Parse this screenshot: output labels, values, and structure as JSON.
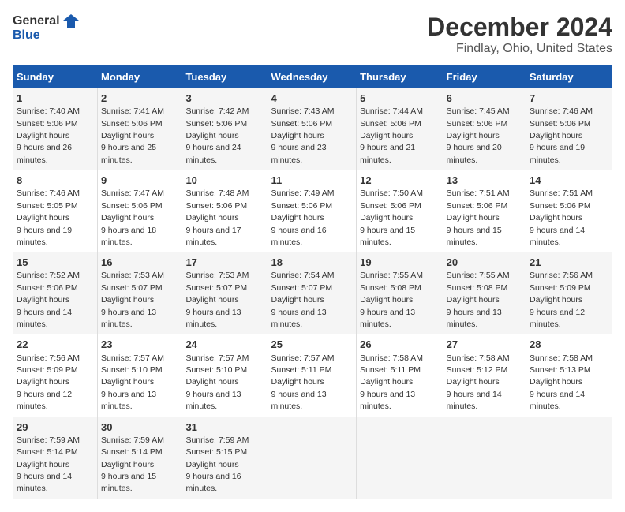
{
  "logo": {
    "line1": "General",
    "line2": "Blue"
  },
  "title": "December 2024",
  "subtitle": "Findlay, Ohio, United States",
  "days_of_week": [
    "Sunday",
    "Monday",
    "Tuesday",
    "Wednesday",
    "Thursday",
    "Friday",
    "Saturday"
  ],
  "weeks": [
    [
      {
        "day": "1",
        "sunrise": "7:40 AM",
        "sunset": "5:06 PM",
        "daylight": "9 hours and 26 minutes."
      },
      {
        "day": "2",
        "sunrise": "7:41 AM",
        "sunset": "5:06 PM",
        "daylight": "9 hours and 25 minutes."
      },
      {
        "day": "3",
        "sunrise": "7:42 AM",
        "sunset": "5:06 PM",
        "daylight": "9 hours and 24 minutes."
      },
      {
        "day": "4",
        "sunrise": "7:43 AM",
        "sunset": "5:06 PM",
        "daylight": "9 hours and 23 minutes."
      },
      {
        "day": "5",
        "sunrise": "7:44 AM",
        "sunset": "5:06 PM",
        "daylight": "9 hours and 21 minutes."
      },
      {
        "day": "6",
        "sunrise": "7:45 AM",
        "sunset": "5:06 PM",
        "daylight": "9 hours and 20 minutes."
      },
      {
        "day": "7",
        "sunrise": "7:46 AM",
        "sunset": "5:06 PM",
        "daylight": "9 hours and 19 minutes."
      }
    ],
    [
      {
        "day": "8",
        "sunrise": "7:46 AM",
        "sunset": "5:05 PM",
        "daylight": "9 hours and 19 minutes."
      },
      {
        "day": "9",
        "sunrise": "7:47 AM",
        "sunset": "5:06 PM",
        "daylight": "9 hours and 18 minutes."
      },
      {
        "day": "10",
        "sunrise": "7:48 AM",
        "sunset": "5:06 PM",
        "daylight": "9 hours and 17 minutes."
      },
      {
        "day": "11",
        "sunrise": "7:49 AM",
        "sunset": "5:06 PM",
        "daylight": "9 hours and 16 minutes."
      },
      {
        "day": "12",
        "sunrise": "7:50 AM",
        "sunset": "5:06 PM",
        "daylight": "9 hours and 15 minutes."
      },
      {
        "day": "13",
        "sunrise": "7:51 AM",
        "sunset": "5:06 PM",
        "daylight": "9 hours and 15 minutes."
      },
      {
        "day": "14",
        "sunrise": "7:51 AM",
        "sunset": "5:06 PM",
        "daylight": "9 hours and 14 minutes."
      }
    ],
    [
      {
        "day": "15",
        "sunrise": "7:52 AM",
        "sunset": "5:06 PM",
        "daylight": "9 hours and 14 minutes."
      },
      {
        "day": "16",
        "sunrise": "7:53 AM",
        "sunset": "5:07 PM",
        "daylight": "9 hours and 13 minutes."
      },
      {
        "day": "17",
        "sunrise": "7:53 AM",
        "sunset": "5:07 PM",
        "daylight": "9 hours and 13 minutes."
      },
      {
        "day": "18",
        "sunrise": "7:54 AM",
        "sunset": "5:07 PM",
        "daylight": "9 hours and 13 minutes."
      },
      {
        "day": "19",
        "sunrise": "7:55 AM",
        "sunset": "5:08 PM",
        "daylight": "9 hours and 13 minutes."
      },
      {
        "day": "20",
        "sunrise": "7:55 AM",
        "sunset": "5:08 PM",
        "daylight": "9 hours and 13 minutes."
      },
      {
        "day": "21",
        "sunrise": "7:56 AM",
        "sunset": "5:09 PM",
        "daylight": "9 hours and 12 minutes."
      }
    ],
    [
      {
        "day": "22",
        "sunrise": "7:56 AM",
        "sunset": "5:09 PM",
        "daylight": "9 hours and 12 minutes."
      },
      {
        "day": "23",
        "sunrise": "7:57 AM",
        "sunset": "5:10 PM",
        "daylight": "9 hours and 13 minutes."
      },
      {
        "day": "24",
        "sunrise": "7:57 AM",
        "sunset": "5:10 PM",
        "daylight": "9 hours and 13 minutes."
      },
      {
        "day": "25",
        "sunrise": "7:57 AM",
        "sunset": "5:11 PM",
        "daylight": "9 hours and 13 minutes."
      },
      {
        "day": "26",
        "sunrise": "7:58 AM",
        "sunset": "5:11 PM",
        "daylight": "9 hours and 13 minutes."
      },
      {
        "day": "27",
        "sunrise": "7:58 AM",
        "sunset": "5:12 PM",
        "daylight": "9 hours and 14 minutes."
      },
      {
        "day": "28",
        "sunrise": "7:58 AM",
        "sunset": "5:13 PM",
        "daylight": "9 hours and 14 minutes."
      }
    ],
    [
      {
        "day": "29",
        "sunrise": "7:59 AM",
        "sunset": "5:14 PM",
        "daylight": "9 hours and 14 minutes."
      },
      {
        "day": "30",
        "sunrise": "7:59 AM",
        "sunset": "5:14 PM",
        "daylight": "9 hours and 15 minutes."
      },
      {
        "day": "31",
        "sunrise": "7:59 AM",
        "sunset": "5:15 PM",
        "daylight": "9 hours and 16 minutes."
      },
      null,
      null,
      null,
      null
    ]
  ],
  "labels": {
    "sunrise": "Sunrise:",
    "sunset": "Sunset:",
    "daylight": "Daylight hours"
  }
}
